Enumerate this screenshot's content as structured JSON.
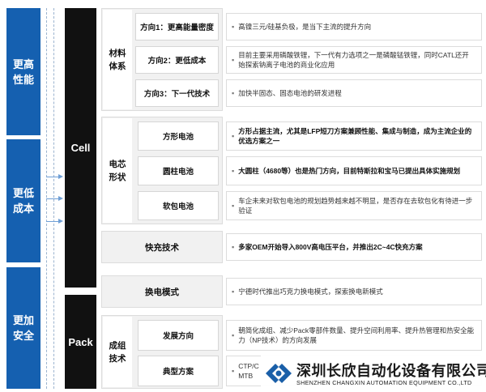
{
  "goals": [
    "更高性能",
    "更低成本",
    "更加安全"
  ],
  "cell_label": "Cell",
  "pack_label": "Pack",
  "groups": {
    "materials": {
      "label": "材料体系",
      "rows": [
        {
          "sub": "方向1：更高能量密度",
          "desc": "高镍三元/硅基负极，是当下主流的提升方向"
        },
        {
          "sub": "方向2：更低成本",
          "desc": "目前主要采用磷酸铁锂，下一代有力选项之一是磷酸锰铁锂，同时CATL还开始探索钠离子电池的商业化应用"
        },
        {
          "sub": "方向3：下一代技术",
          "desc": "加快半固态、固态电池的研发进程"
        }
      ]
    },
    "form": {
      "label": "电芯形状",
      "rows": [
        {
          "sub": "方形电池",
          "desc": "方形占据主流，尤其是LFP短刀方案兼顾性能、集成与制造，成为主流企业的优选方案之一"
        },
        {
          "sub": "圆柱电池",
          "desc": "大圆柱（4680等）也是热门方向，目前特斯拉和宝马已提出具体实施规划"
        },
        {
          "sub": "软包电池",
          "desc": "车企未来对软包电池的规划趋势越来越不明显，是否存在去软包化有待进一步验证"
        }
      ]
    },
    "fast": {
      "label": "快充技术",
      "desc": "多家OEM开始导入800V高电压平台，并推出2C~4C快充方案"
    },
    "swap": {
      "label": "换电模式",
      "desc": "宁德时代推出巧克力换电模式，探索换电新模式"
    },
    "integration": {
      "label": "成组技术",
      "rows": [
        {
          "sub": "发展方向",
          "desc": "朝简化成组、减少Pack零部件数量、提升空间利用率、提升热管理和热安全能力（NP技术）的方向发展"
        },
        {
          "sub": "典型方案",
          "desc": "CTP/C MTB"
        }
      ]
    }
  },
  "logo": {
    "title": "深圳长欣自动化设备有限公司",
    "subtitle": "SHENZHEN CHANGXIN AUTOMATION EQUIPMENT CO.,LTD",
    "brand_color": "#1a5fa8"
  },
  "colors": {
    "goal_blue": "#1560b0",
    "black_bar": "#111111",
    "panel_gray": "#f1f1f1"
  }
}
